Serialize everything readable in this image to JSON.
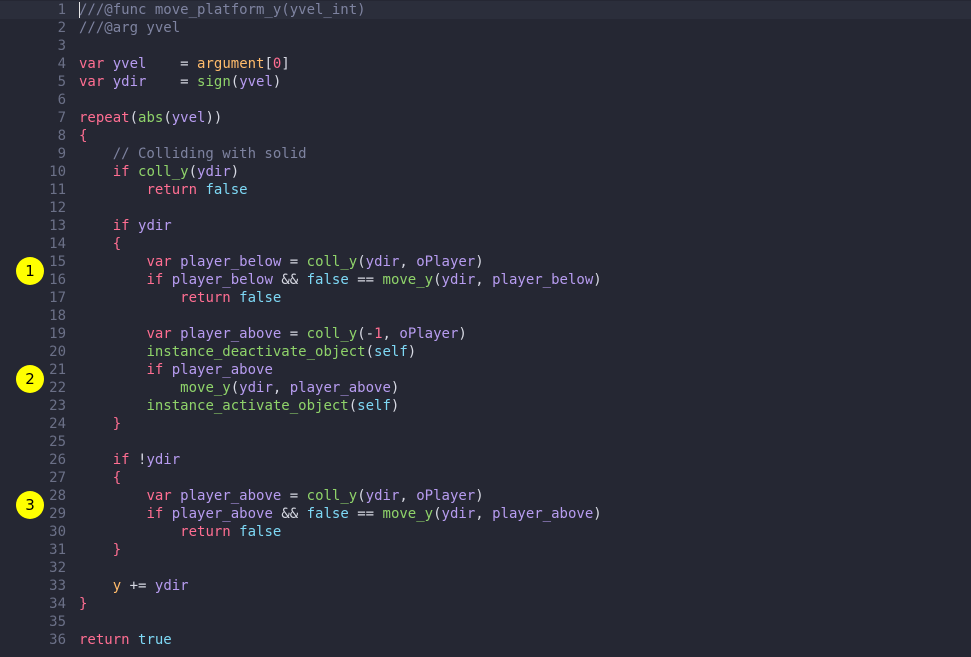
{
  "editor": {
    "cursor_line": 1,
    "lines": [
      {
        "n": "1",
        "tokens": [
          {
            "t": "com",
            "v": "///@func move_platform_y(yvel_int)"
          }
        ]
      },
      {
        "n": "2",
        "tokens": [
          {
            "t": "com",
            "v": "///@arg yvel"
          }
        ]
      },
      {
        "n": "3",
        "tokens": []
      },
      {
        "n": "4",
        "tokens": [
          {
            "t": "kw",
            "v": "var"
          },
          {
            "t": "txt",
            "v": " "
          },
          {
            "t": "var",
            "v": "yvel"
          },
          {
            "t": "txt",
            "v": "    "
          },
          {
            "t": "op",
            "v": "="
          },
          {
            "t": "txt",
            "v": " "
          },
          {
            "t": "id",
            "v": "argument"
          },
          {
            "t": "punc",
            "v": "["
          },
          {
            "t": "num",
            "v": "0"
          },
          {
            "t": "punc",
            "v": "]"
          }
        ]
      },
      {
        "n": "5",
        "tokens": [
          {
            "t": "kw",
            "v": "var"
          },
          {
            "t": "txt",
            "v": " "
          },
          {
            "t": "var",
            "v": "ydir"
          },
          {
            "t": "txt",
            "v": "    "
          },
          {
            "t": "op",
            "v": "="
          },
          {
            "t": "txt",
            "v": " "
          },
          {
            "t": "fn",
            "v": "sign"
          },
          {
            "t": "punc",
            "v": "("
          },
          {
            "t": "var",
            "v": "yvel"
          },
          {
            "t": "punc",
            "v": ")"
          }
        ]
      },
      {
        "n": "6",
        "tokens": []
      },
      {
        "n": "7",
        "tokens": [
          {
            "t": "kw",
            "v": "repeat"
          },
          {
            "t": "punc",
            "v": "("
          },
          {
            "t": "fn",
            "v": "abs"
          },
          {
            "t": "punc",
            "v": "("
          },
          {
            "t": "var",
            "v": "yvel"
          },
          {
            "t": "punc",
            "v": "))"
          }
        ]
      },
      {
        "n": "8",
        "tokens": [
          {
            "t": "kw",
            "v": "{"
          }
        ]
      },
      {
        "n": "9",
        "tokens": [
          {
            "t": "txt",
            "v": "    "
          },
          {
            "t": "com",
            "v": "// Colliding with solid"
          }
        ]
      },
      {
        "n": "10",
        "tokens": [
          {
            "t": "txt",
            "v": "    "
          },
          {
            "t": "kw",
            "v": "if"
          },
          {
            "t": "txt",
            "v": " "
          },
          {
            "t": "fn",
            "v": "coll_y"
          },
          {
            "t": "punc",
            "v": "("
          },
          {
            "t": "var",
            "v": "ydir"
          },
          {
            "t": "punc",
            "v": ")"
          }
        ]
      },
      {
        "n": "11",
        "tokens": [
          {
            "t": "txt",
            "v": "        "
          },
          {
            "t": "kw",
            "v": "return"
          },
          {
            "t": "txt",
            "v": " "
          },
          {
            "t": "const",
            "v": "false"
          }
        ]
      },
      {
        "n": "12",
        "tokens": []
      },
      {
        "n": "13",
        "tokens": [
          {
            "t": "txt",
            "v": "    "
          },
          {
            "t": "kw",
            "v": "if"
          },
          {
            "t": "txt",
            "v": " "
          },
          {
            "t": "var",
            "v": "ydir"
          }
        ]
      },
      {
        "n": "14",
        "tokens": [
          {
            "t": "txt",
            "v": "    "
          },
          {
            "t": "kw",
            "v": "{"
          }
        ]
      },
      {
        "n": "15",
        "tokens": [
          {
            "t": "txt",
            "v": "        "
          },
          {
            "t": "kw",
            "v": "var"
          },
          {
            "t": "txt",
            "v": " "
          },
          {
            "t": "var",
            "v": "player_below"
          },
          {
            "t": "txt",
            "v": " "
          },
          {
            "t": "op",
            "v": "="
          },
          {
            "t": "txt",
            "v": " "
          },
          {
            "t": "fn",
            "v": "coll_y"
          },
          {
            "t": "punc",
            "v": "("
          },
          {
            "t": "var",
            "v": "ydir"
          },
          {
            "t": "punc",
            "v": ", "
          },
          {
            "t": "var",
            "v": "oPlayer"
          },
          {
            "t": "punc",
            "v": ")"
          }
        ]
      },
      {
        "n": "16",
        "tokens": [
          {
            "t": "txt",
            "v": "        "
          },
          {
            "t": "kw",
            "v": "if"
          },
          {
            "t": "txt",
            "v": " "
          },
          {
            "t": "var",
            "v": "player_below"
          },
          {
            "t": "txt",
            "v": " "
          },
          {
            "t": "op",
            "v": "&&"
          },
          {
            "t": "txt",
            "v": " "
          },
          {
            "t": "const",
            "v": "false"
          },
          {
            "t": "txt",
            "v": " "
          },
          {
            "t": "op",
            "v": "=="
          },
          {
            "t": "txt",
            "v": " "
          },
          {
            "t": "fn",
            "v": "move_y"
          },
          {
            "t": "punc",
            "v": "("
          },
          {
            "t": "var",
            "v": "ydir"
          },
          {
            "t": "punc",
            "v": ", "
          },
          {
            "t": "var",
            "v": "player_below"
          },
          {
            "t": "punc",
            "v": ")"
          }
        ]
      },
      {
        "n": "17",
        "tokens": [
          {
            "t": "txt",
            "v": "            "
          },
          {
            "t": "kw",
            "v": "return"
          },
          {
            "t": "txt",
            "v": " "
          },
          {
            "t": "const",
            "v": "false"
          }
        ]
      },
      {
        "n": "18",
        "tokens": []
      },
      {
        "n": "19",
        "tokens": [
          {
            "t": "txt",
            "v": "        "
          },
          {
            "t": "kw",
            "v": "var"
          },
          {
            "t": "txt",
            "v": " "
          },
          {
            "t": "var",
            "v": "player_above"
          },
          {
            "t": "txt",
            "v": " "
          },
          {
            "t": "op",
            "v": "="
          },
          {
            "t": "txt",
            "v": " "
          },
          {
            "t": "fn",
            "v": "coll_y"
          },
          {
            "t": "punc",
            "v": "("
          },
          {
            "t": "op",
            "v": "-"
          },
          {
            "t": "num",
            "v": "1"
          },
          {
            "t": "punc",
            "v": ", "
          },
          {
            "t": "var",
            "v": "oPlayer"
          },
          {
            "t": "punc",
            "v": ")"
          }
        ]
      },
      {
        "n": "20",
        "tokens": [
          {
            "t": "txt",
            "v": "        "
          },
          {
            "t": "fn",
            "v": "instance_deactivate_object"
          },
          {
            "t": "punc",
            "v": "("
          },
          {
            "t": "const",
            "v": "self"
          },
          {
            "t": "punc",
            "v": ")"
          }
        ]
      },
      {
        "n": "21",
        "tokens": [
          {
            "t": "txt",
            "v": "        "
          },
          {
            "t": "kw",
            "v": "if"
          },
          {
            "t": "txt",
            "v": " "
          },
          {
            "t": "var",
            "v": "player_above"
          }
        ]
      },
      {
        "n": "22",
        "tokens": [
          {
            "t": "txt",
            "v": "            "
          },
          {
            "t": "fn",
            "v": "move_y"
          },
          {
            "t": "punc",
            "v": "("
          },
          {
            "t": "var",
            "v": "ydir"
          },
          {
            "t": "punc",
            "v": ", "
          },
          {
            "t": "var",
            "v": "player_above"
          },
          {
            "t": "punc",
            "v": ")"
          }
        ]
      },
      {
        "n": "23",
        "tokens": [
          {
            "t": "txt",
            "v": "        "
          },
          {
            "t": "fn",
            "v": "instance_activate_object"
          },
          {
            "t": "punc",
            "v": "("
          },
          {
            "t": "const",
            "v": "self"
          },
          {
            "t": "punc",
            "v": ")"
          }
        ]
      },
      {
        "n": "24",
        "tokens": [
          {
            "t": "txt",
            "v": "    "
          },
          {
            "t": "kw",
            "v": "}"
          }
        ]
      },
      {
        "n": "25",
        "tokens": []
      },
      {
        "n": "26",
        "tokens": [
          {
            "t": "txt",
            "v": "    "
          },
          {
            "t": "kw",
            "v": "if"
          },
          {
            "t": "txt",
            "v": " "
          },
          {
            "t": "op",
            "v": "!"
          },
          {
            "t": "var",
            "v": "ydir"
          }
        ]
      },
      {
        "n": "27",
        "tokens": [
          {
            "t": "txt",
            "v": "    "
          },
          {
            "t": "kw",
            "v": "{"
          }
        ]
      },
      {
        "n": "28",
        "tokens": [
          {
            "t": "txt",
            "v": "        "
          },
          {
            "t": "kw",
            "v": "var"
          },
          {
            "t": "txt",
            "v": " "
          },
          {
            "t": "var",
            "v": "player_above"
          },
          {
            "t": "txt",
            "v": " "
          },
          {
            "t": "op",
            "v": "="
          },
          {
            "t": "txt",
            "v": " "
          },
          {
            "t": "fn",
            "v": "coll_y"
          },
          {
            "t": "punc",
            "v": "("
          },
          {
            "t": "var",
            "v": "ydir"
          },
          {
            "t": "punc",
            "v": ", "
          },
          {
            "t": "var",
            "v": "oPlayer"
          },
          {
            "t": "punc",
            "v": ")"
          }
        ]
      },
      {
        "n": "29",
        "tokens": [
          {
            "t": "txt",
            "v": "        "
          },
          {
            "t": "kw",
            "v": "if"
          },
          {
            "t": "txt",
            "v": " "
          },
          {
            "t": "var",
            "v": "player_above"
          },
          {
            "t": "txt",
            "v": " "
          },
          {
            "t": "op",
            "v": "&&"
          },
          {
            "t": "txt",
            "v": " "
          },
          {
            "t": "const",
            "v": "false"
          },
          {
            "t": "txt",
            "v": " "
          },
          {
            "t": "op",
            "v": "=="
          },
          {
            "t": "txt",
            "v": " "
          },
          {
            "t": "fn",
            "v": "move_y"
          },
          {
            "t": "punc",
            "v": "("
          },
          {
            "t": "var",
            "v": "ydir"
          },
          {
            "t": "punc",
            "v": ", "
          },
          {
            "t": "var",
            "v": "player_above"
          },
          {
            "t": "punc",
            "v": ")"
          }
        ]
      },
      {
        "n": "30",
        "tokens": [
          {
            "t": "txt",
            "v": "            "
          },
          {
            "t": "kw",
            "v": "return"
          },
          {
            "t": "txt",
            "v": " "
          },
          {
            "t": "const",
            "v": "false"
          }
        ]
      },
      {
        "n": "31",
        "tokens": [
          {
            "t": "txt",
            "v": "    "
          },
          {
            "t": "kw",
            "v": "}"
          }
        ]
      },
      {
        "n": "32",
        "tokens": []
      },
      {
        "n": "33",
        "tokens": [
          {
            "t": "txt",
            "v": "    "
          },
          {
            "t": "id",
            "v": "y"
          },
          {
            "t": "txt",
            "v": " "
          },
          {
            "t": "op",
            "v": "+="
          },
          {
            "t": "txt",
            "v": " "
          },
          {
            "t": "var",
            "v": "ydir"
          }
        ]
      },
      {
        "n": "34",
        "tokens": [
          {
            "t": "kw",
            "v": "}"
          }
        ]
      },
      {
        "n": "35",
        "tokens": []
      },
      {
        "n": "36",
        "tokens": [
          {
            "t": "kw",
            "v": "return"
          },
          {
            "t": "txt",
            "v": " "
          },
          {
            "t": "const",
            "v": "true"
          }
        ]
      }
    ]
  },
  "markers": [
    {
      "label": "1",
      "line": "16"
    },
    {
      "label": "2",
      "line": "22"
    },
    {
      "label": "3",
      "line": "29"
    }
  ],
  "colors": {
    "background": "#252733",
    "current_line": "#2b2e3b",
    "line_number": "#6b7087",
    "keyword": "#ff6e92",
    "variable": "#b79cf0",
    "function": "#8fd36a",
    "constant": "#7ed8f5",
    "comment": "#7e83a0",
    "identifier": "#ffbb6b",
    "marker": "#ffff00"
  }
}
